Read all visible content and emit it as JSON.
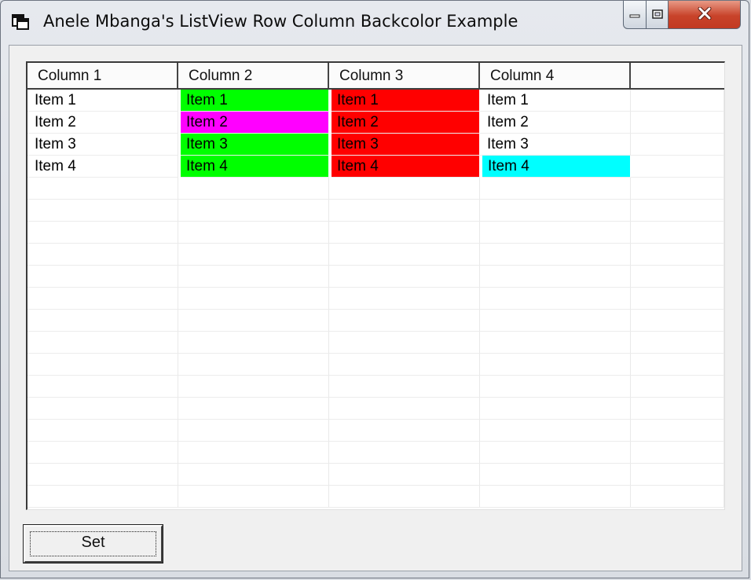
{
  "window": {
    "title": "Anele Mbanga's ListView Row Column Backcolor Example",
    "app_icon": "window-icon"
  },
  "caption_buttons": [
    {
      "name": "minimize",
      "icon": "minimize-icon"
    },
    {
      "name": "maximize",
      "icon": "maximize-icon"
    },
    {
      "name": "close",
      "icon": "close-icon"
    }
  ],
  "listview": {
    "columns": [
      "Column 1",
      "Column 2",
      "Column 3",
      "Column 4"
    ],
    "rows": [
      {
        "cells": [
          {
            "text": "Item 1",
            "bg": null
          },
          {
            "text": "Item 1",
            "bg": "#00ff00"
          },
          {
            "text": "Item 1",
            "bg": "#ff0000"
          },
          {
            "text": "Item 1",
            "bg": null
          }
        ]
      },
      {
        "cells": [
          {
            "text": "Item 2",
            "bg": null
          },
          {
            "text": "Item 2",
            "bg": "#ff00ff"
          },
          {
            "text": "Item 2",
            "bg": "#ff0000"
          },
          {
            "text": "Item 2",
            "bg": null
          }
        ]
      },
      {
        "cells": [
          {
            "text": "Item 3",
            "bg": null
          },
          {
            "text": "Item 3",
            "bg": "#00ff00"
          },
          {
            "text": "Item 3",
            "bg": "#ff0000"
          },
          {
            "text": "Item 3",
            "bg": null
          }
        ]
      },
      {
        "cells": [
          {
            "text": "Item 4",
            "bg": null
          },
          {
            "text": "Item 4",
            "bg": "#00ff00"
          },
          {
            "text": "Item 4",
            "bg": "#ff0000"
          },
          {
            "text": "Item 4",
            "bg": "#00ffff"
          }
        ]
      }
    ]
  },
  "buttons": {
    "set_label": "Set"
  }
}
